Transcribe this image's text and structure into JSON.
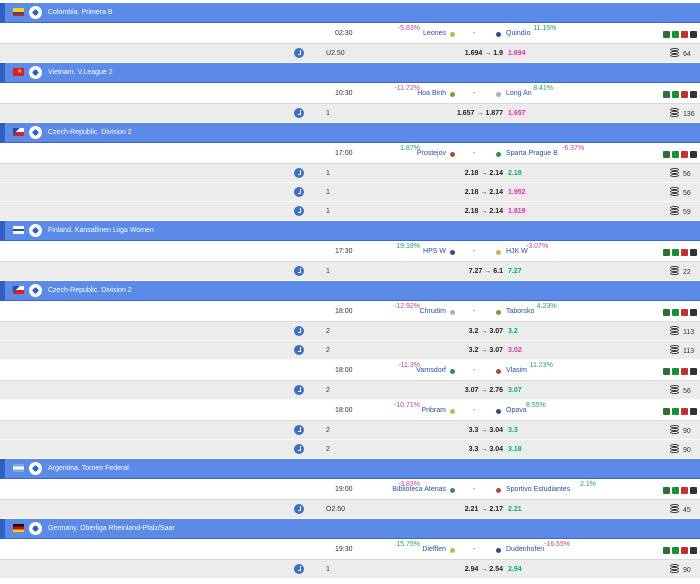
{
  "colors": {
    "league_bg": "#5b8ae8",
    "team_link": "#2a4f9e",
    "negative": "#c0449a",
    "positive": "#23a06a",
    "odds_row_bg": "#ececec"
  },
  "icons": {
    "sport": "soccer-ball-icon",
    "clock": "clock-icon",
    "coins": "coin-stack-icon",
    "action_green": "check-icon",
    "action_red": "close-icon",
    "action_dark": "chart-icon"
  },
  "arrow": "→",
  "dash": "-",
  "leagues": [
    {
      "flag": "colombia",
      "name": "Colombia. Primera B",
      "matches": [
        {
          "time": "02:30",
          "home": "Leones",
          "home_pct": "-5.83%",
          "away": "Quindío",
          "away_pct": "11.15%",
          "odds": [
            {
              "market": "U2.50",
              "from": "1.694",
              "to": "1.9",
              "current": "1.694",
              "dir": "neg",
              "count": "64"
            }
          ]
        }
      ]
    },
    {
      "flag": "vietnam",
      "name": "Vietnam. V.League 2",
      "matches": [
        {
          "time": "10:30",
          "home": "Hoa Binh",
          "home_pct": "-11.72%",
          "away": "Long An",
          "away_pct": "8.41%",
          "odds": [
            {
              "market": "1",
              "from": "1.657",
              "to": "1.877",
              "current": "1.657",
              "dir": "neg",
              "count": "136"
            }
          ]
        }
      ]
    },
    {
      "flag": "czech",
      "name": "Czech-Republic. Division 2",
      "matches": [
        {
          "time": "17:00",
          "home": "Prostejov",
          "home_pct": "1.87%",
          "away": "Sparta Prague B",
          "away_pct": "-6.37%",
          "odds": [
            {
              "market": "1",
              "from": "2.18",
              "to": "2.14",
              "current": "2.18",
              "dir": "pos",
              "count": "56"
            },
            {
              "market": "1",
              "from": "2.18",
              "to": "2.14",
              "current": "1.952",
              "dir": "neg",
              "count": "56"
            },
            {
              "market": "1",
              "from": "2.18",
              "to": "2.14",
              "current": "1.819",
              "dir": "neg",
              "count": "59"
            }
          ]
        }
      ]
    },
    {
      "flag": "finland",
      "name": "Finland. Kansallinen Liiga Women",
      "matches": [
        {
          "time": "17:30",
          "home": "HPS W",
          "home_pct": "19.18%",
          "away": "HJK W",
          "away_pct": "-3.07%",
          "odds": [
            {
              "market": "1",
              "from": "7.27",
              "to": "6.1",
              "current": "7.27",
              "dir": "pos",
              "count": "22"
            }
          ]
        }
      ]
    },
    {
      "flag": "czech",
      "name": "Czech-Republic. Division 2",
      "matches": [
        {
          "time": "18:00",
          "home": "Chrudim",
          "home_pct": "-12.92%",
          "away": "Taborsko",
          "away_pct": "4.23%",
          "odds": [
            {
              "market": "2",
              "from": "3.2",
              "to": "3.07",
              "current": "3.2",
              "dir": "pos",
              "count": "113"
            },
            {
              "market": "2",
              "from": "3.2",
              "to": "3.07",
              "current": "3.02",
              "dir": "neg",
              "count": "113"
            }
          ]
        },
        {
          "time": "18:00",
          "home": "Varnsdorf",
          "home_pct": "-11.3%",
          "away": "Vlasim",
          "away_pct": "11.23%",
          "odds": [
            {
              "market": "2",
              "from": "3.07",
              "to": "2.76",
              "current": "3.07",
              "dir": "pos",
              "count": "56"
            }
          ]
        },
        {
          "time": "18:00",
          "home": "Pribram",
          "home_pct": "-10.71%",
          "away": "Opava",
          "away_pct": "8.55%",
          "odds": [
            {
              "market": "2",
              "from": "3.3",
              "to": "3.04",
              "current": "3.3",
              "dir": "pos",
              "count": "90"
            },
            {
              "market": "2",
              "from": "3.3",
              "to": "3.04",
              "current": "3.18",
              "dir": "pos",
              "count": "90"
            }
          ]
        }
      ]
    },
    {
      "flag": "argentina",
      "name": "Argentina. Torneo Federal",
      "matches": [
        {
          "time": "19:00",
          "home": "Biblioteca Atenas",
          "home_pct": "-3.83%",
          "away": "Sportivo Estudiantes",
          "away_pct": "2.1%",
          "odds": [
            {
              "market": "O2.50",
              "from": "2.21",
              "to": "2.17",
              "current": "2.21",
              "dir": "pos",
              "count": "45"
            }
          ]
        }
      ]
    },
    {
      "flag": "germany",
      "name": "Germany. Oberliga Rheinland-Pfalz/Saar",
      "matches": [
        {
          "time": "19:30",
          "home": "Diefflen",
          "home_pct": "15.75%",
          "away": "Dudenhofen",
          "away_pct": "-16.55%",
          "odds": [
            {
              "market": "1",
              "from": "2.94",
              "to": "2.54",
              "current": "2.94",
              "dir": "pos",
              "count": "90"
            }
          ]
        }
      ]
    }
  ]
}
